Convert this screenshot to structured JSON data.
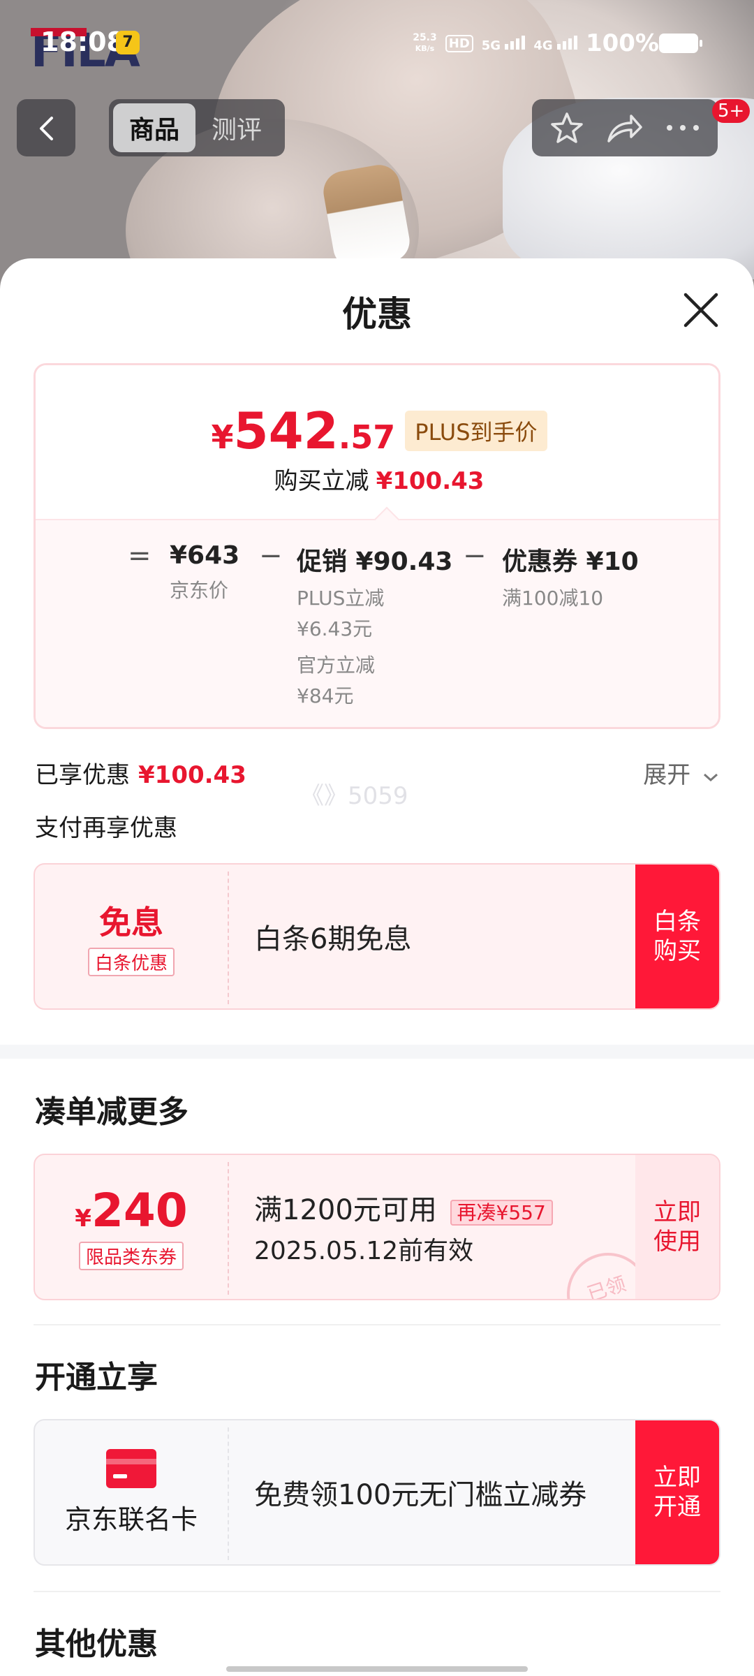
{
  "status_bar": {
    "time": "18:08",
    "speed_value": "25.3",
    "speed_unit": "KB/s",
    "hd": "HD",
    "sim1": "1",
    "sim2": "2",
    "net1": "5G",
    "net2": "4G",
    "battery": "100%"
  },
  "hero": {
    "brand_logo": "FILA"
  },
  "nav": {
    "tabs": [
      "商品",
      "测评"
    ],
    "badge": "5+"
  },
  "sheet": {
    "title": "优惠",
    "price_card": {
      "currency": "¥",
      "price_int": "542",
      "price_dec": ".57",
      "plus_tag": "PLUS到手价",
      "reduce_label": "购买立减",
      "reduce_value": "¥100.43",
      "eq": "=",
      "minus": "−",
      "jd_price": "¥643",
      "jd_price_label": "京东价",
      "promo_main": "促销 ¥90.43",
      "promo_sub1": "PLUS立减",
      "promo_sub1_val": "¥6.43元",
      "promo_sub2": "官方立减",
      "promo_sub2_val": "¥84元",
      "coupon_main": "优惠券 ¥10",
      "coupon_sub": "满100减10"
    },
    "enjoyed_label": "已享优惠",
    "enjoyed_value": "¥100.43",
    "expand_label": "展开",
    "watermark": "《》5059",
    "pay_again": "支付再享优惠",
    "baitiao": {
      "big": "免息",
      "tag": "白条优惠",
      "desc": "白条6期免息",
      "btn": "白条\n购买"
    },
    "section_combine": "凑单减更多",
    "combine_coupon": {
      "currency": "¥",
      "amount": "240",
      "tag": "限品类东券",
      "line1": "满1200元可用",
      "extra": "再凑¥557",
      "line2": "2025.05.12前有效",
      "stamp": "已领",
      "btn": "立即\n使用"
    },
    "section_open": "开通立享",
    "card_offer": {
      "name": "京东联名卡",
      "desc": "免费领100元无门槛立减券",
      "btn": "立即\n开通"
    },
    "section_other": "其他优惠"
  },
  "colors": {
    "accent": "#e8162f",
    "button_red": "#ff1838"
  }
}
